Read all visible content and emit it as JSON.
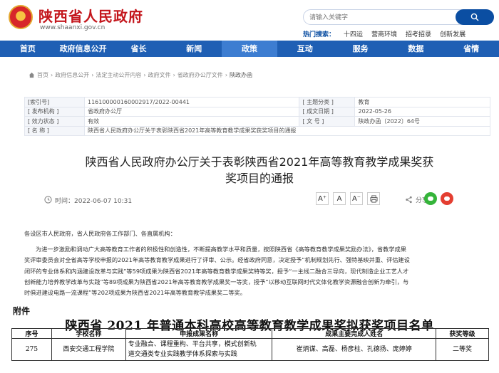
{
  "header": {
    "site_title": "陕西省人民政府",
    "site_url": "www.shaanxi.gov.cn",
    "search_placeholder": "请输入关键字",
    "hot_label": "热门搜索：",
    "hot_tags": [
      "十四运",
      "营商环境",
      "招考招录",
      "创新发展"
    ]
  },
  "nav": {
    "items": [
      "首页",
      "政府信息公开",
      "省长",
      "新闻",
      "政策",
      "互动",
      "服务",
      "数据",
      "省情"
    ],
    "active_index": 4
  },
  "breadcrumb": [
    "首页",
    "政府信息公开",
    "法定主动公开内容",
    "政府文件",
    "省政府办公厅文件",
    "陕政办函"
  ],
  "meta": {
    "index_label": "[索引号]",
    "index_value": "116100000160002917/2022-00441",
    "topic_label": "[ 主题分类 ]",
    "topic_value": "教育",
    "issuer_label": "[ 发布机构 ]",
    "issuer_value": "省政府办公厅",
    "date_label": "[ 成文日期 ]",
    "date_value": "2022-05-26",
    "status_label": "[ 效力状态 ]",
    "status_value": "有效",
    "docno_label": "[ 文 号 ]",
    "docno_value": "陕政办函〔2022〕64号",
    "name_label": "[ 名 称 ]",
    "name_value": "陕西省人民政府办公厅关于表彰陕西省2021年高等教育教学成果奖获奖项目的通报"
  },
  "article": {
    "title_line1": "陕西省人民政府办公厅关于表彰陕西省2021年高等教育教学成果奖获",
    "title_line2": "奖项目的通报",
    "publish_time": "时间：2022-06-07 10:31",
    "font_large": "A⁺",
    "font_mid": "A",
    "font_small": "A⁻",
    "share_label": "分享:",
    "greeting": "各设区市人民政府，省人民政府各工作部门、各直属机构：",
    "body_lines": [
      "为进一步激励和调动广大高等教育工作者的积极性和创造性，不断提高教学水平和质量，按照陕西省《高等教育教学成果奖励办法》，省教学成果",
      "奖评审委员会对全省高等学校申报的2021年高等教育教学成果进行了评审、公示。经省政府同意，决定授予“机制规划先行、强特基映并重、评估建设",
      "闭环的专业体系和内涵建设改革与实践”等59项成果为陕西省2021年高等教育教学成果奖特等奖，授予“一主线二融合三导向，现代制造企业工艺人才",
      "创新能力培养教学改革与实践”等89项成果为陕西省2021年高等教育教学成果奖一等奖，授予“以移动互联网时代文体化教学资源融合创新为牵引，与",
      "时俱进建设电路一流课程”等202项成果为陕西省2021年高等教育教学成果奖二等奖。"
    ]
  },
  "attachment": {
    "label": "附件",
    "title": "陕西省 2021 年普通本科高校高等教育教学成果奖拟获奖项目名单",
    "headers": [
      "序号",
      "学校名称",
      "申报成果名称",
      "成果主要完成人姓名",
      "获奖等级"
    ],
    "rows": [
      {
        "no": "275",
        "school": "西安交通工程学院",
        "project_line1": "专业融合、课程重构、平台共享，模式创新轨",
        "project_line2": "道交通类专业实践教学体系探索与实践",
        "people": "崔炳谋、高磊、杨彦柱、孔德扬、庞婷婷",
        "level": "二等奖"
      }
    ]
  }
}
